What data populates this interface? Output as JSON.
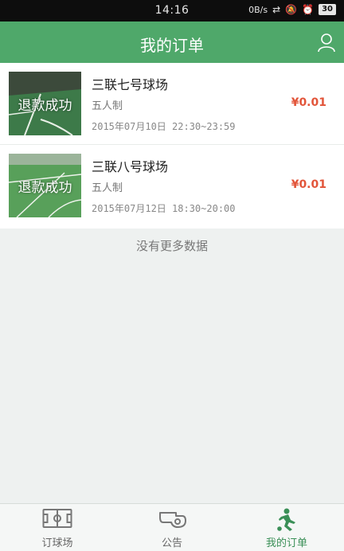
{
  "status_bar": {
    "time": "14:16",
    "net_speed": "0B/s",
    "battery": "30"
  },
  "header": {
    "title": "我的订单",
    "profile_icon": "user-icon"
  },
  "orders": [
    {
      "status": "退款成功",
      "name": "三联七号球场",
      "type": "五人制",
      "time": "2015年07月10日 22:30~23:59",
      "price": "¥0.01"
    },
    {
      "status": "退款成功",
      "name": "三联八号球场",
      "type": "五人制",
      "time": "2015年07月12日 18:30~20:00",
      "price": "¥0.01"
    }
  ],
  "list_footer": "没有更多数据",
  "tabs": [
    {
      "label": "订球场",
      "icon": "pitch-icon",
      "active": false
    },
    {
      "label": "公告",
      "icon": "whistle-icon",
      "active": false
    },
    {
      "label": "我的订单",
      "icon": "player-kick-icon",
      "active": true
    }
  ],
  "colors": {
    "accent": "#4fa86a",
    "price": "#e2553a",
    "active_tab": "#3a8f57"
  }
}
